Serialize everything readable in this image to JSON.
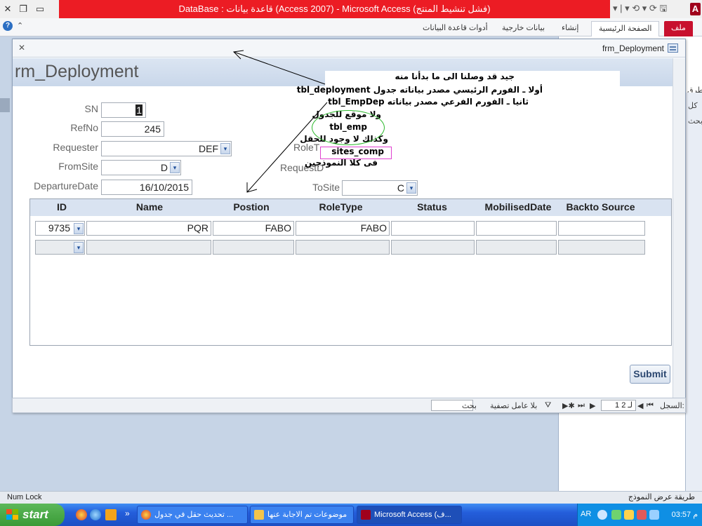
{
  "window": {
    "title": "DataBase : قاعدة بيانات (Access 2007) - Microsoft Access (فشل تنشيط المنتج)",
    "app_letter": "A"
  },
  "qat": {
    "items": "▾ | ▾ ⟲ ▾ ⟳ 🖫"
  },
  "ribbon": {
    "tabs": [
      {
        "label": "ملف"
      },
      {
        "label": "الصفحة الرئيسية"
      },
      {
        "label": "إنشاء"
      },
      {
        "label": "بيانات خارجية"
      },
      {
        "label": "أدوات قاعدة البيانات"
      }
    ]
  },
  "nav_pane": {
    "side_label_1": "طرق",
    "side_label_2": "كل",
    "side_label_3": "بحث"
  },
  "form": {
    "window_title": "frm_Deployment",
    "heading": "rm_Deployment",
    "fields": {
      "sn": {
        "label": "SN",
        "value": "1"
      },
      "refno": {
        "label": "RefNo",
        "value": "245"
      },
      "requester": {
        "label": "Requester",
        "value": "DEF"
      },
      "fromsite": {
        "label": "FromSite",
        "value": "D"
      },
      "departure": {
        "label": "DepartureDate",
        "value": "16/10/2015"
      },
      "roletype": {
        "label": "RoleT"
      },
      "requestdate": {
        "label": "RequestD"
      },
      "tosite": {
        "label": "ToSite",
        "value": "C"
      }
    },
    "dropdown_glyph": "▾",
    "subform": {
      "columns": [
        "ID",
        "Name",
        "Postion",
        "RoleType",
        "Status",
        "MobilisedDate",
        "Backto Source"
      ],
      "rows": [
        {
          "id": "9735",
          "name": "PQR",
          "position": "FABO",
          "roletype": "FABO",
          "status": "",
          "mobilised": "",
          "backto": ""
        }
      ]
    },
    "submit_label": "Submit"
  },
  "annotation": {
    "lines": [
      "جيد قد وصلنا الى ما بدأنا منه",
      "أولا ـ الفورم الرئيسي  مصدر بياناته جدول tbl_deployment",
      "ثانيا ـ الفورم الفرعي مصدر بياناته  tbl_EmpDep",
      "ولا موقع للجدول",
      "tbl_emp",
      "وكذلك لا وجود للحقل",
      "sites_comp",
      "فى كلا النموذجين"
    ]
  },
  "record_nav": {
    "label": "السجل:",
    "first": "⏮",
    "prev": "◀",
    "position": "1 لـ 2",
    "next": "▶",
    "last": "⏭",
    "new": "▶✱",
    "filter": "بلا عامل تصفية",
    "search_label": "بحث",
    "search_value": ""
  },
  "status_bar": {
    "left": "Num Lock",
    "right": "طريقة عرض النموذج"
  },
  "taskbar": {
    "start": "start",
    "tasks": [
      {
        "label": "تحديث حقل في جدول ..."
      },
      {
        "label": "موضوعات تم الاجابة عنها"
      },
      {
        "label": "Microsoft Access (ف..."
      }
    ],
    "tray_lang": "AR",
    "tray_time": "03:57 م",
    "overflow": "»"
  },
  "colors": {
    "title_red": "#ec1c24",
    "file_tab": "#c8102e",
    "header_blue": "#d9e3f1",
    "taskbar_blue": "#245edb",
    "start_green": "#3a9a36"
  }
}
